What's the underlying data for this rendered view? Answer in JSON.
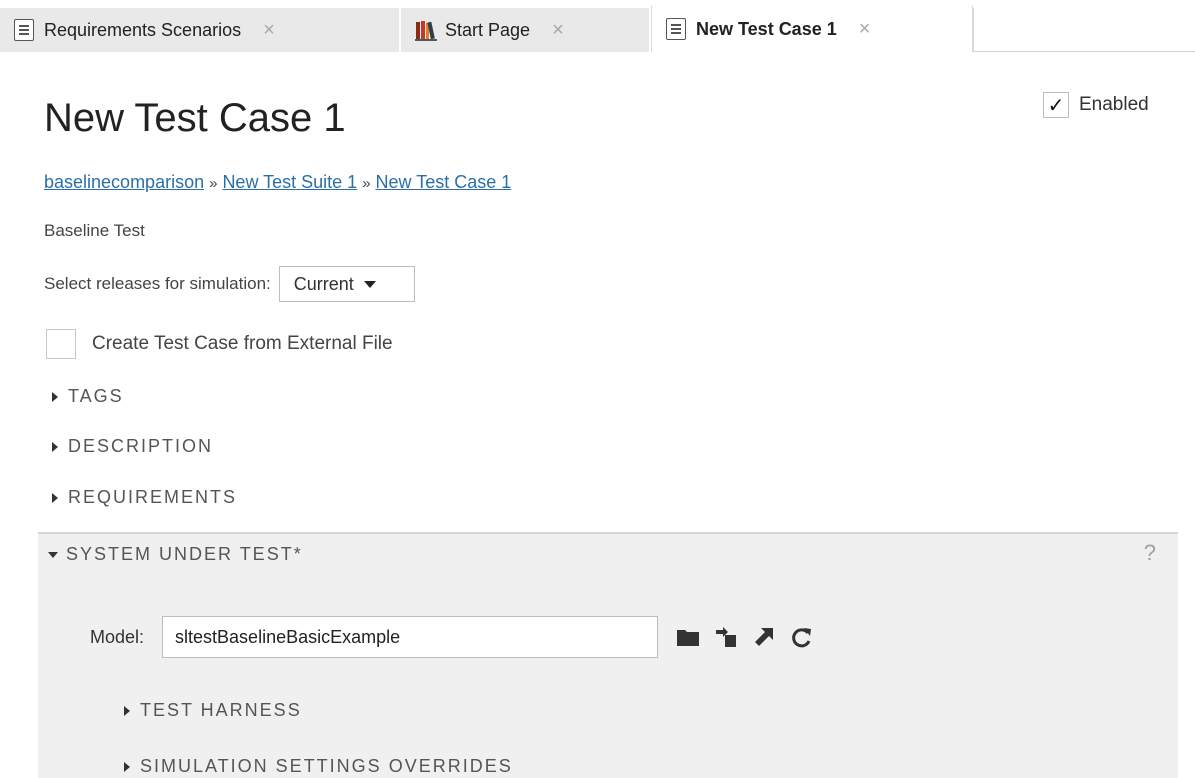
{
  "tabs": [
    {
      "label": "Requirements Scenarios",
      "icon": "document-icon",
      "close": "×"
    },
    {
      "label": "Start Page",
      "icon": "library-books-icon",
      "close": "×"
    },
    {
      "label": "New Test Case 1",
      "icon": "document-icon",
      "close": "×",
      "active": true
    }
  ],
  "header": {
    "title": "New Test Case 1",
    "enabled_label": "Enabled",
    "enabled_checked": true,
    "check_glyph": "✓"
  },
  "breadcrumb": {
    "items": [
      "baselinecomparison",
      "New Test Suite 1",
      "New Test Case 1"
    ],
    "separator": "»"
  },
  "test_type": "Baseline Test",
  "releases": {
    "label": "Select releases for simulation:",
    "selected": "Current"
  },
  "external_file": {
    "label": "Create Test Case from External File",
    "checked": false
  },
  "sections": {
    "tags": "TAGS",
    "description": "DESCRIPTION",
    "requirements": "REQUIREMENTS"
  },
  "system_under_test": {
    "title": "SYSTEM UNDER TEST*",
    "help": "?",
    "model_label": "Model:",
    "model_value": "sltestBaselineBasicExample",
    "tools": [
      "folder-icon",
      "open-model-icon",
      "use-current-model-icon",
      "refresh-icon"
    ],
    "sub_sections": {
      "test_harness": "TEST HARNESS",
      "sim_overrides": "SIMULATION SETTINGS OVERRIDES"
    }
  },
  "colors": {
    "link": "#2b6fa8",
    "panel_bg": "#f0f0f0",
    "tab_bg": "#e9e9e9"
  }
}
